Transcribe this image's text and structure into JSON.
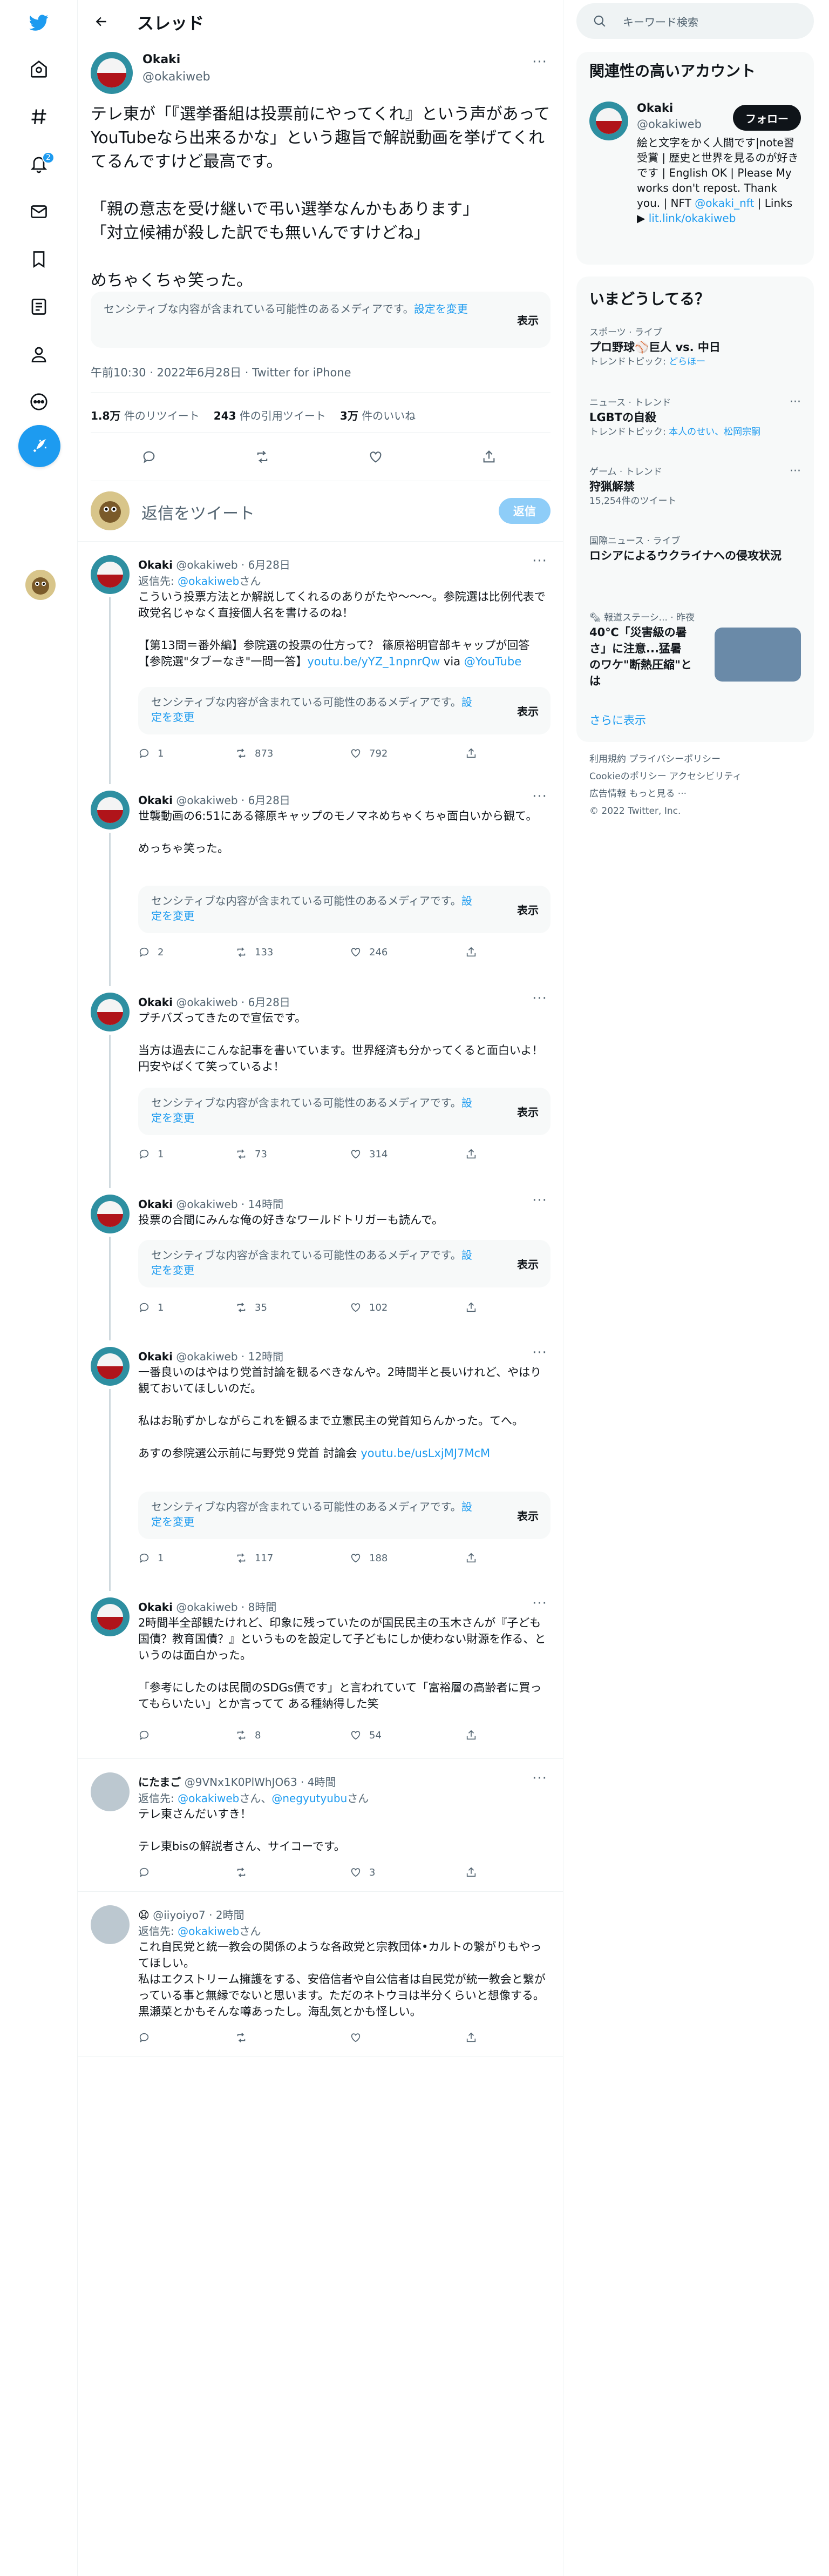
{
  "colors": {
    "accent": "#1d9bf0",
    "text": "#0f1419",
    "muted": "#536471",
    "border": "#eff3f4"
  },
  "nav": {
    "items": [
      "home-icon",
      "explore-icon",
      "notifications-icon",
      "messages-icon",
      "bookmarks-icon",
      "lists-icon",
      "profile-icon",
      "more-icon"
    ],
    "notification_count": "2"
  },
  "header": {
    "title": "スレッド"
  },
  "main_tweet": {
    "name": "Okaki",
    "handle": "@okakiweb",
    "text": "テレ東が「『選挙番組は投票前にやってくれ』という声があってYouTubeなら出来るかな」という趣旨で解説動画を挙げてくれてるんですけど最高です。\n\n「親の意志を受け継いで弔い選挙なんかもあります」\n「対立候補が殺した訳でも無いんですけどね」\n\nめちゃくちゃ笑った。",
    "sensitive_text": "センシティブな内容が含まれている可能性のあるメディアです。",
    "sensitive_link": "設定を変更",
    "show_label": "表示",
    "timestamp": "午前10:30 · 2022年6月28日 · Twitter for iPhone",
    "retweets_count": "1.8万",
    "retweets_label": "件のリツイート",
    "quotes_count": "243",
    "quotes_label": "件の引用ツイート",
    "likes_count": "3万",
    "likes_label": "件のいいね"
  },
  "reply_box": {
    "placeholder": "返信をツイート",
    "button": "返信"
  },
  "replies": [
    {
      "name": "Okaki",
      "handle": "@okakiweb",
      "time": "6月28日",
      "reply_to_prefix": "返信先: ",
      "reply_to": "@okakiweb",
      "reply_to_suffix": "さん",
      "text": "こういう投票方法とか解説してくれるのありがたや〜〜〜。参院選は比例代表で政党名じゃなく直接個人名を書けるのね！\n\n【第13問＝番外編】参院選の投票の仕方って？ 篠原裕明官部キャップが回答【参院選\"タブーなき\"一問一答】",
      "link1": "youtu.be/yYZ_1npnrQw",
      "link_via": " via ",
      "link2": "@YouTube",
      "sensitive_text": "センシティブな内容が含まれている可能性のあるメディアです。",
      "sensitive_link": "設定を変更",
      "show_label": "表示",
      "replies": "1",
      "retweets": "873",
      "likes": "792"
    },
    {
      "name": "Okaki",
      "handle": "@okakiweb",
      "time": "6月28日",
      "text": "世襲動画の6:51にある篠原キャップのモノマネめちゃくちゃ面白いから観て。\n\nめっちゃ笑った。",
      "sensitive_text": "センシティブな内容が含まれている可能性のあるメディアです。",
      "sensitive_link": "設定を変更",
      "show_label": "表示",
      "replies": "2",
      "retweets": "133",
      "likes": "246"
    },
    {
      "name": "Okaki",
      "handle": "@okakiweb",
      "time": "6月28日",
      "text": "プチバズってきたので宣伝です。\n\n当方は過去にこんな記事を書いています。世界経済も分かってくると面白いよ！円安やばくて笑っているよ！",
      "sensitive_text": "センシティブな内容が含まれている可能性のあるメディアです。",
      "sensitive_link": "設定を変更",
      "show_label": "表示",
      "replies": "1",
      "retweets": "73",
      "likes": "314"
    },
    {
      "name": "Okaki",
      "handle": "@okakiweb",
      "time": "14時間",
      "text": "投票の合間にみんな俺の好きなワールドトリガーも読んで。",
      "sensitive_text": "センシティブな内容が含まれている可能性のあるメディアです。",
      "sensitive_link": "設定を変更",
      "show_label": "表示",
      "replies": "1",
      "retweets": "35",
      "likes": "102"
    },
    {
      "name": "Okaki",
      "handle": "@okakiweb",
      "time": "12時間",
      "text": "一番良いのはやはり党首討論を観るべきなんや。2時間半と長いけれど、やはり観ておいてほしいのだ。\n\n私はお恥ずかしながらこれを観るまで立憲民主の党首知らんかった。てへ。\n\nあすの参院選公示前に与野党９党首 討論会",
      "link1": "youtu.be/usLxjMJ7McM",
      "sensitive_text": "センシティブな内容が含まれている可能性のあるメディアです。",
      "sensitive_link": "設定を変更",
      "show_label": "表示",
      "replies": "1",
      "retweets": "117",
      "likes": "188"
    },
    {
      "name": "Okaki",
      "handle": "@okakiweb",
      "time": "8時間",
      "text": "2時間半全部観たけれど、印象に残っていたのが国民民主の玉木さんが『子ども国債？教育国債？』というものを設定して子どもにしか使わない財源を作る、というのは面白かった。\n\n「参考にしたのは民間のSDGs債です」と言われていて「富裕層の高齢者に買ってもらいたい」とか言ってて ある種納得した笑",
      "replies": "",
      "retweets": "8",
      "likes": "54"
    },
    {
      "name": "にたまご",
      "handle": "@9VNx1K0PlWhJO63",
      "time": "4時間",
      "reply_to_prefix": "返信先: ",
      "reply_to": "@okakiweb",
      "reply_to_mid": "さん、",
      "reply_to2": "@negyutyubu",
      "reply_to_suffix": "さん",
      "text": "テレ東さんだいすき！\n\nテレ東bisの解説者さん、サイコーです。",
      "replies": "",
      "retweets": "",
      "likes": "3"
    },
    {
      "name": "😧",
      "handle": "@iiyoiyo7",
      "time": "2時間",
      "reply_to_prefix": "返信先: ",
      "reply_to": "@okakiweb",
      "reply_to_suffix": "さん",
      "text": "これ自民党と統一教会の関係のような各政党と宗教団体•カルトの繋がりもやってほしい。\n私はエクストリーム擁護をする、安倍信者や自公信者は自民党が統一教会と繋がっている事と無縁でないと思います。ただのネトウヨは半分くらいと想像する。黒瀬菜とかもそんな噂あったし。海乱気とかも怪しい。",
      "replies": "",
      "retweets": "",
      "likes": ""
    }
  ],
  "search": {
    "placeholder": "キーワード検索"
  },
  "relevant": {
    "title": "関連性の高いアカウント",
    "name": "Okaki",
    "handle": "@okakiweb",
    "follow": "フォロー",
    "bio": "絵と文字をかく人間です|note習受賞 | 歴史と世界を見るのが好きです | English OK | Please My works don't repost. Thank you. | NFT ",
    "bio_link1": "@okaki_nft",
    "bio_mid": " | Links ▶ ",
    "bio_link2": "lit.link/okakiweb"
  },
  "trends": {
    "title": "いまどうしてる？",
    "items": [
      {
        "meta": "スポーツ · ライブ",
        "name": "プロ野球⚾巨人 vs. 中日",
        "sub_label": "トレンドトピック: ",
        "sub_link": "どらほー"
      },
      {
        "meta": "ニュース · トレンド",
        "name": "LGBTの自殺",
        "sub_label": "トレンドトピック: ",
        "sub_link": "本人のせい、松岡宗嗣"
      },
      {
        "meta": "ゲーム · トレンド",
        "name": "狩猟解禁",
        "sub": "15,254件のツイート"
      },
      {
        "meta": "国際ニュース · ライブ",
        "name": "ロシアによるウクライナへの侵攻状況"
      },
      {
        "meta": "報道ステーシ... · 昨夜",
        "name": "40℃「災害級の暑さ」に注意...猛暑のワケ\"断熱圧縮\"とは"
      }
    ],
    "show_more": "さらに表示"
  },
  "footer": {
    "line1": "利用規約   プライバシーポリシー",
    "line2": "Cookieのポリシー   アクセシビリティ",
    "line3": "広告情報   もっと見る ···",
    "line4": "© 2022 Twitter, Inc."
  }
}
